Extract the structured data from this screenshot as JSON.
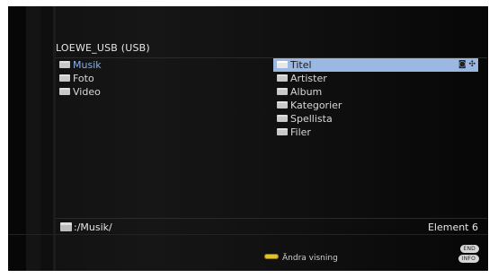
{
  "title": "LOEWE_USB (USB)",
  "left_list": [
    {
      "label": "Musik"
    },
    {
      "label": "Foto"
    },
    {
      "label": "Video"
    }
  ],
  "right_list": [
    {
      "label": "Titel",
      "selected": true
    },
    {
      "label": "Artister"
    },
    {
      "label": "Album"
    },
    {
      "label": "Kategorier"
    },
    {
      "label": "Spellista"
    },
    {
      "label": "Filer"
    }
  ],
  "selected_item_icons": "◙ ✣",
  "path": ":/Musik/",
  "element_count": "Element 6",
  "footer": {
    "hint_label": "Ändra visning",
    "hint_color": "#e2c22a",
    "key_end": "END",
    "key_info": "INFO"
  }
}
